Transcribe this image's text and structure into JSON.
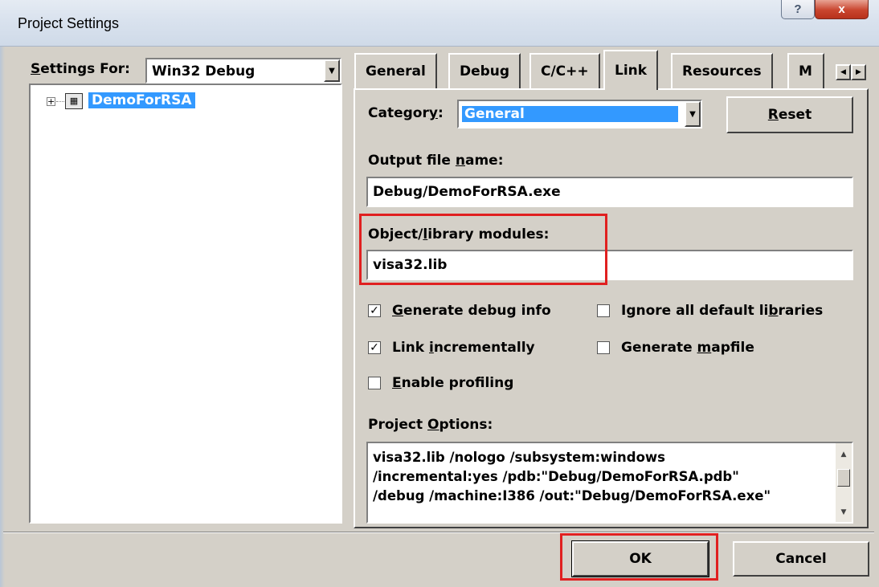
{
  "window": {
    "title": "Project Settings",
    "help_label": "?",
    "close_label": "x"
  },
  "left": {
    "settings_for_label_u": "S",
    "settings_for_label_rest": "ettings For:",
    "settings_for_value": "Win32 Debug",
    "tree": {
      "expander": "+",
      "item": "DemoForRSA"
    }
  },
  "tabs": [
    {
      "label": "General"
    },
    {
      "label": "Debug"
    },
    {
      "label": "C/C++"
    },
    {
      "label": "Link"
    },
    {
      "label": "Resources"
    },
    {
      "label": "M"
    }
  ],
  "link": {
    "category_label_a": "Categor",
    "category_label_u": "y",
    "category_label_b": ":",
    "category_value": "General",
    "reset_u": "R",
    "reset_rest": "eset",
    "output_label_a": "Output file ",
    "output_label_u": "n",
    "output_label_b": "ame:",
    "output_value": "Debug/DemoForRSA.exe",
    "objlib_label_a": "Object/",
    "objlib_label_u": "l",
    "objlib_label_b": "ibrary modules:",
    "objlib_value": "visa32.lib",
    "checks": {
      "debug_info": {
        "checked": true,
        "u": "G",
        "rest": "enerate debug info"
      },
      "ignore_libs": {
        "checked": false,
        "a": "Ignore all default li",
        "u": "b",
        "b": "raries"
      },
      "incremental": {
        "checked": true,
        "a": "Link ",
        "u": "i",
        "b": "ncrementally"
      },
      "mapfile": {
        "checked": false,
        "a": "Generate ",
        "u": "m",
        "b": "apfile"
      },
      "profiling": {
        "checked": false,
        "u": "E",
        "rest": "nable profiling"
      }
    },
    "options_label_a": "Project ",
    "options_label_u": "O",
    "options_label_b": "ptions:",
    "options_text": "visa32.lib /nologo /subsystem:windows\n/incremental:yes /pdb:\"Debug/DemoForRSA.pdb\"\n/debug /machine:I386 /out:\"Debug/DemoForRSA.exe\""
  },
  "footer": {
    "ok": "OK",
    "cancel": "Cancel"
  },
  "colors": {
    "face": "#d4d0c8",
    "selection": "#3399ff",
    "highlight_box": "#e02020"
  }
}
